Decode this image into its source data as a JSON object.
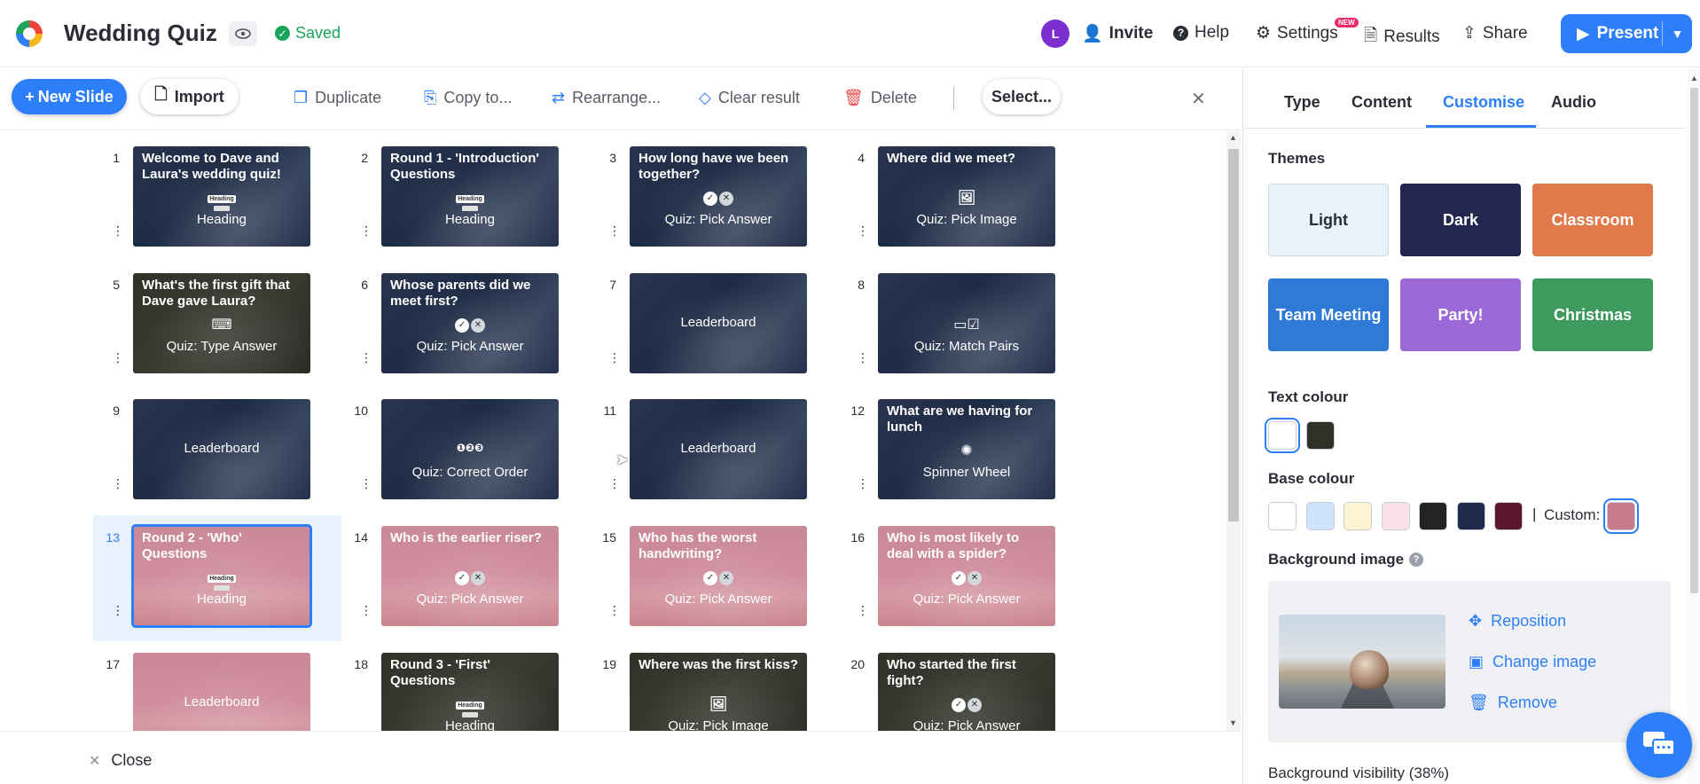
{
  "header": {
    "title": "Wedding Quiz",
    "saved": "Saved",
    "avatar_letter": "L",
    "invite": "Invite",
    "help": "Help",
    "settings": "Settings",
    "settings_badge": "NEW",
    "results": "Results",
    "share": "Share",
    "present": "Present"
  },
  "toolbar": {
    "new_slide": "New Slide",
    "import": "Import",
    "duplicate": "Duplicate",
    "copy_to": "Copy to...",
    "rearrange": "Rearrange...",
    "clear_result": "Clear result",
    "delete": "Delete",
    "select": "Select..."
  },
  "slides": [
    {
      "num": "1",
      "title": "Welcome to Dave and Laura's wedding quiz!",
      "label": "Heading",
      "bg": "dark",
      "glyph": "heading"
    },
    {
      "num": "2",
      "title": "Round 1 - 'Introduction' Questions",
      "label": "Heading",
      "bg": "dark",
      "glyph": "heading"
    },
    {
      "num": "3",
      "title": "How long have we been together?",
      "label": "Quiz: Pick Answer",
      "bg": "dark",
      "glyph": "pick"
    },
    {
      "num": "4",
      "title": "Where did we meet?",
      "label": "Quiz: Pick Image",
      "bg": "dark",
      "glyph": "image"
    },
    {
      "num": "5",
      "title": "What's the first gift that Dave gave Laura?",
      "label": "Quiz: Type Answer",
      "bg": "olive",
      "glyph": "keyboard"
    },
    {
      "num": "6",
      "title": "Whose parents did we meet first?",
      "label": "Quiz: Pick Answer",
      "bg": "dark",
      "glyph": "pick"
    },
    {
      "num": "7",
      "title": "",
      "label": "Leaderboard",
      "bg": "dark",
      "glyph": "none"
    },
    {
      "num": "8",
      "title": "",
      "label": "Quiz: Match Pairs",
      "bg": "dark",
      "glyph": "match"
    },
    {
      "num": "9",
      "title": "",
      "label": "Leaderboard",
      "bg": "dark",
      "glyph": "none"
    },
    {
      "num": "10",
      "title": "",
      "label": "Quiz: Correct Order",
      "bg": "dark",
      "glyph": "order"
    },
    {
      "num": "11",
      "title": "",
      "label": "Leaderboard",
      "bg": "dark",
      "glyph": "none"
    },
    {
      "num": "12",
      "title": "What are we having for lunch",
      "label": "Spinner Wheel",
      "bg": "dark",
      "glyph": "spinner"
    },
    {
      "num": "13",
      "title": "Round 2 - 'Who' Questions",
      "label": "Heading",
      "bg": "pink",
      "glyph": "heading",
      "selected": true
    },
    {
      "num": "14",
      "title": "Who is the earlier riser?",
      "label": "Quiz: Pick Answer",
      "bg": "pink",
      "glyph": "pick"
    },
    {
      "num": "15",
      "title": "Who has the worst handwriting?",
      "label": "Quiz: Pick Answer",
      "bg": "pink",
      "glyph": "pick"
    },
    {
      "num": "16",
      "title": "Who is most likely to deal with a spider?",
      "label": "Quiz: Pick Answer",
      "bg": "pink",
      "glyph": "pick"
    },
    {
      "num": "17",
      "title": "",
      "label": "Leaderboard",
      "bg": "pink",
      "glyph": "none"
    },
    {
      "num": "18",
      "title": "Round 3 - 'First' Questions",
      "label": "Heading",
      "bg": "olive",
      "glyph": "heading"
    },
    {
      "num": "19",
      "title": "Where was the first kiss?",
      "label": "Quiz: Pick Image",
      "bg": "olive",
      "glyph": "image"
    },
    {
      "num": "20",
      "title": "Who started the first fight?",
      "label": "Quiz: Pick Answer",
      "bg": "olive",
      "glyph": "pick"
    }
  ],
  "glyph_text": {
    "heading": "Heading"
  },
  "footer": {
    "close": "Close"
  },
  "panel": {
    "tabs": [
      "Type",
      "Content",
      "Customise",
      "Audio"
    ],
    "active_tab": "Customise",
    "themes_label": "Themes",
    "themes": [
      {
        "name": "Light",
        "bg": "#e8f2fb",
        "fg": "#2b2d35"
      },
      {
        "name": "Dark",
        "bg": "#23264d",
        "fg": "#ffffff"
      },
      {
        "name": "Classroom",
        "bg": "#e07a4a",
        "fg": "#ffffff"
      },
      {
        "name": "Team Meeting",
        "bg": "#2e7ad6",
        "fg": "#ffffff"
      },
      {
        "name": "Party!",
        "bg": "#9b6ad8",
        "fg": "#ffffff"
      },
      {
        "name": "Christmas",
        "bg": "#3f9a5e",
        "fg": "#ffffff"
      }
    ],
    "text_colour_label": "Text colour",
    "text_colours": [
      "#ffffff",
      "#2f3028"
    ],
    "base_colour_label": "Base colour",
    "base_colours": [
      "#ffffff",
      "#cfe3fa",
      "#fdf3d3",
      "#fbe1ea",
      "#232323",
      "#1f2a4d",
      "#5a1730"
    ],
    "custom_label": "Custom:",
    "custom_colour": "#c77a8a",
    "background_image_label": "Background image",
    "reposition": "Reposition",
    "change_image": "Change image",
    "remove": "Remove",
    "background_visibility": "Background visibility (38%)"
  }
}
